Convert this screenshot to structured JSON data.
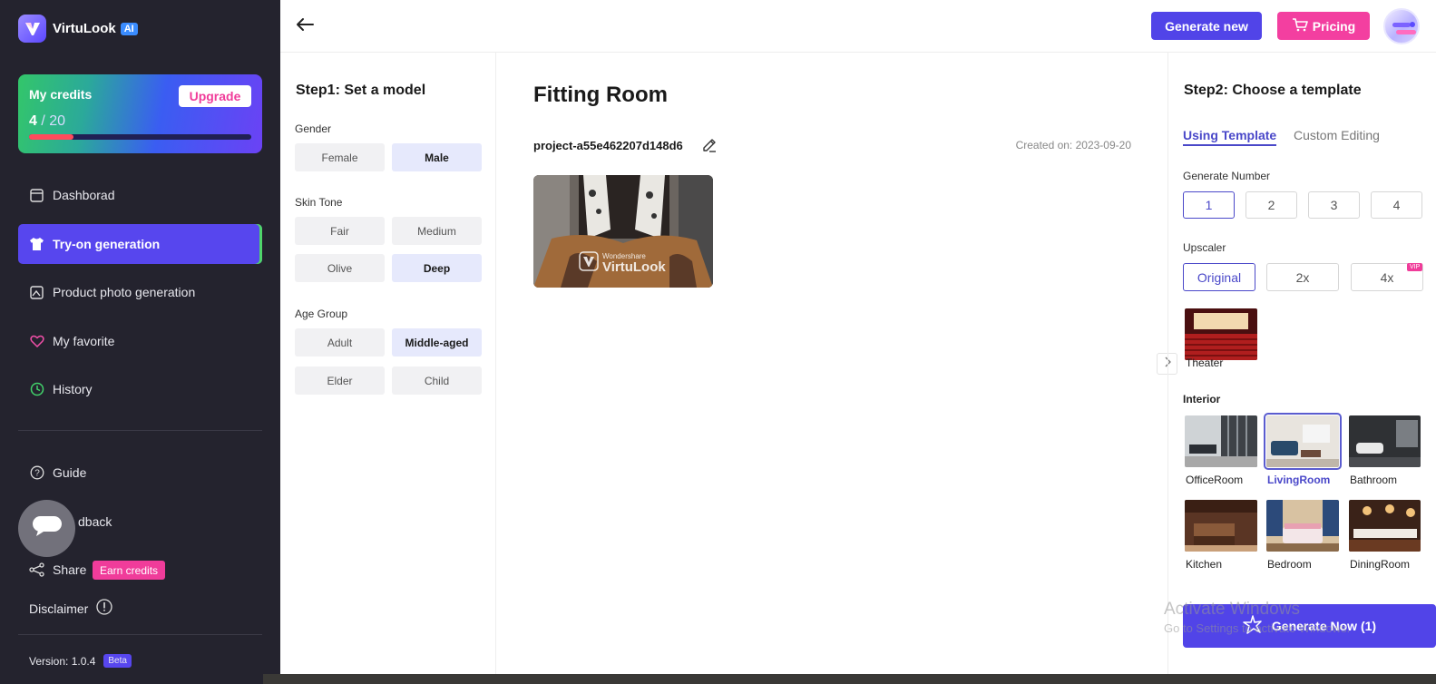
{
  "sidebar": {
    "logo": {
      "name": "VirtuLook",
      "badge": "AI"
    },
    "credits": {
      "title": "My credits",
      "used": "4",
      "total": " / 20",
      "progress": 0.2,
      "upgrade_label": "Upgrade"
    },
    "nav": [
      {
        "label": "Dashborad",
        "icon": "dashboard-icon"
      },
      {
        "label": "Try-on generation",
        "icon": "shirt-icon",
        "active": true
      },
      {
        "label": "Product photo generation",
        "icon": "photo-icon"
      },
      {
        "label": "My favorite",
        "icon": "heart-icon"
      },
      {
        "label": "History",
        "icon": "clock-icon"
      }
    ],
    "bottom_nav": [
      {
        "label": "Guide",
        "icon": "help-icon"
      },
      {
        "label": "dback",
        "icon": "feedback-icon"
      },
      {
        "label": "Share",
        "icon": "share-icon"
      }
    ],
    "earn_label": "Earn credits",
    "disclaimer_label": "Disclaimer",
    "version_label": "Version: 1.0.4",
    "beta_label": "Beta"
  },
  "topbar": {
    "generate_new_label": "Generate new",
    "pricing_label": "Pricing"
  },
  "step1": {
    "title": "Step1:  Set a model",
    "gender": {
      "label": "Gender",
      "options": [
        "Female",
        "Male"
      ],
      "selected": "Male"
    },
    "skin_tone": {
      "label": "Skin Tone",
      "options": [
        "Fair",
        "Medium",
        "Olive",
        "Deep"
      ],
      "selected": "Deep"
    },
    "age_group": {
      "label": "Age Group",
      "options": [
        "Adult",
        "Middle-aged",
        "Elder",
        "Child"
      ],
      "selected": "Middle-aged"
    }
  },
  "main": {
    "title": "Fitting Room",
    "project_name": "project-a55e462207d148d6",
    "created_label": "Created on:  2023-09-20",
    "thumbnail_watermark": {
      "brand": "Wondershare",
      "product": "VirtuLook"
    }
  },
  "step2": {
    "title": "Step2: Choose a template",
    "tabs": [
      "Using Template",
      "Custom Editing"
    ],
    "generate_number": {
      "label": "Generate Number",
      "options": [
        "1",
        "2",
        "3",
        "4"
      ],
      "selected": "1"
    },
    "upscaler": {
      "label": "Upscaler",
      "options": [
        "Original",
        "2x",
        "4x"
      ],
      "selected": "Original",
      "vip": "VIP"
    },
    "templates_top": [
      {
        "label": "Theater"
      }
    ],
    "interior": {
      "label": "Interior",
      "items": [
        {
          "label": "OfficeRoom"
        },
        {
          "label": "LivingRoom",
          "selected": true
        },
        {
          "label": "Bathroom"
        },
        {
          "label": "Kitchen"
        },
        {
          "label": "Bedroom"
        },
        {
          "label": "DiningRoom"
        }
      ]
    },
    "generate_now_label": "Generate Now (1)"
  },
  "overlay": {
    "line1": "Activate Windows",
    "line2": "Go to Settings to activate Windows."
  },
  "colors": {
    "accent": "#5144e8",
    "pink": "#f33fa0",
    "sidebar_bg": "#24232e"
  }
}
